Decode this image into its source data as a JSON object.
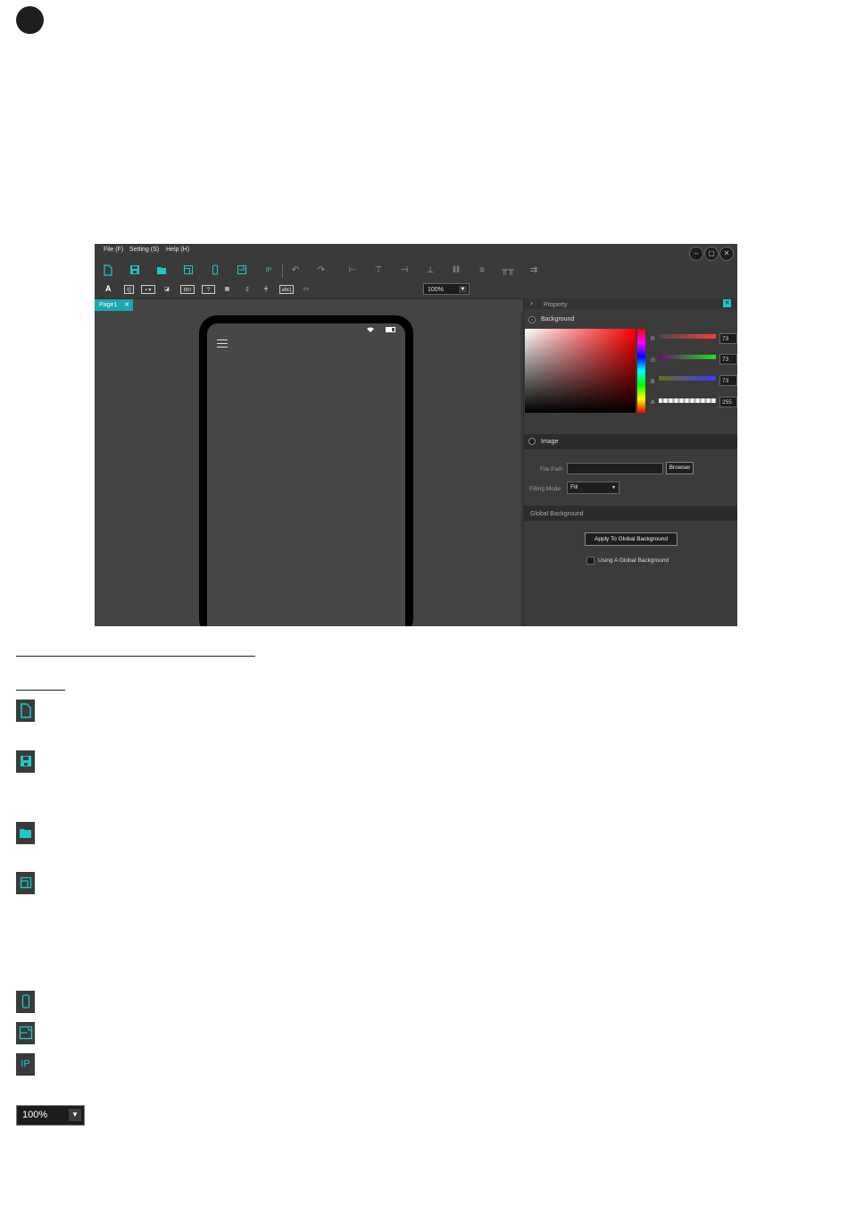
{
  "app": {
    "menu": [
      "File (F)",
      "Setting (S)",
      "Help (H)"
    ],
    "window_controls": [
      "–",
      "▢",
      "✕"
    ],
    "toolbar_main_icons": [
      "new-file-icon",
      "save-icon",
      "open-folder-icon",
      "window-icon",
      "phone-icon",
      "rotate-screen-icon",
      "ip-icon",
      "undo-icon",
      "redo-icon",
      "align-left-icon",
      "align-top-icon",
      "align-right-icon",
      "align-bottom-icon",
      "distribute-horizontal-icon",
      "distribute-vertical-icon",
      "same-width-icon",
      "same-height-icon"
    ],
    "ip_label": "IP",
    "widgets": [
      "A",
      "I|]",
      "▪ ▾",
      "◪",
      "btn",
      "?",
      "▦",
      "▯",
      "┿",
      "abc|",
      "▭"
    ],
    "zoom": "100%",
    "tab": "Page1",
    "property": {
      "title": "Property",
      "background_label": "Background",
      "channels": [
        {
          "name": "R",
          "value": "73",
          "color": "#ff4b4b"
        },
        {
          "name": "G",
          "value": "73",
          "color": "#28d228"
        },
        {
          "name": "B",
          "value": "73",
          "color": "#3c3cff"
        },
        {
          "name": "A",
          "value": "255",
          "color": "#cccccc"
        }
      ],
      "image_label": "Image",
      "file_path_label": "File Path",
      "browser_button": "Browser",
      "filling_mode_label": "Filling Mode",
      "filling_mode_value": "Fill",
      "global_bg_header": "Global Background",
      "apply_button": "Apply To Global Background",
      "using_global_label": "Using A Global Background"
    }
  },
  "doc": {
    "zoom_value": "100%",
    "ip_label": "IP"
  }
}
